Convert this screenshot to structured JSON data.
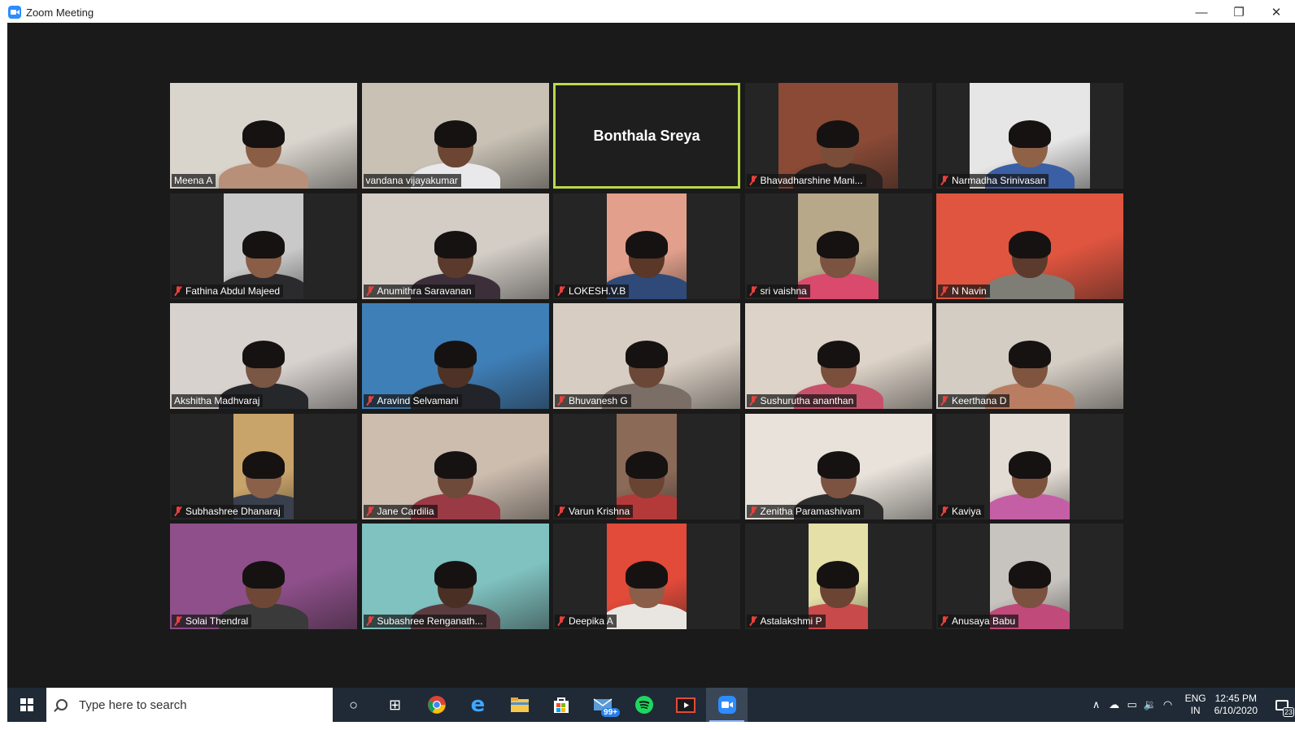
{
  "window": {
    "title": "Zoom Meeting",
    "minimize_glyph": "—",
    "restore_glyph": "❐",
    "close_glyph": "✕"
  },
  "colors": {
    "active_speaker_border": "#b9d94a",
    "muted_icon": "#e8413c",
    "taskbar_bg": "#1f2a36",
    "meeting_bg": "#1a1a1a",
    "zoom_blue": "#2d8cff"
  },
  "participants": [
    {
      "name": "Meena A",
      "muted": false,
      "video": true,
      "bg": "#d9d4cc",
      "skin": "#8a5e45",
      "shirt": "#b88f78",
      "vw": 1.0
    },
    {
      "name": "vandana vijayakumar",
      "muted": false,
      "video": true,
      "bg": "#c8c1b4",
      "skin": "#6c4633",
      "shirt": "#e9e9ec",
      "vw": 1.0
    },
    {
      "name": "Bonthala Sreya",
      "muted": false,
      "video": false,
      "active": true
    },
    {
      "name": "Bhavadharshine Mani...",
      "muted": true,
      "video": true,
      "bg": "#8a4a36",
      "skin": "#7a4d38",
      "shirt": "#2a2220",
      "vw": 0.64
    },
    {
      "name": "Narmadha Srinivasan",
      "muted": true,
      "video": true,
      "bg": "#e6e6e6",
      "skin": "#8f6248",
      "shirt": "#3a5fa4",
      "vw": 0.64
    },
    {
      "name": "Fathina Abdul Majeed",
      "muted": true,
      "video": true,
      "bg": "#c9c9c9",
      "skin": "#8a5d46",
      "shirt": "#2b2b2e",
      "vw": 0.43
    },
    {
      "name": "Anumithra Saravanan",
      "muted": true,
      "video": true,
      "bg": "#d3cdc6",
      "skin": "#5b3a2c",
      "shirt": "#3c2f3a",
      "vw": 1.0
    },
    {
      "name": "LOKESH.V.B",
      "muted": true,
      "video": true,
      "bg": "#e2a08c",
      "skin": "#5a3726",
      "shirt": "#2f4a78",
      "vw": 0.43
    },
    {
      "name": "sri vaishna",
      "muted": true,
      "video": true,
      "bg": "#b8a88a",
      "skin": "#7c5240",
      "shirt": "#d94a6c",
      "vw": 0.43
    },
    {
      "name": "N Navin",
      "muted": true,
      "video": true,
      "bg": "#e0553f",
      "skin": "#5d3b2c",
      "shirt": "#7e7e76",
      "vw": 1.0
    },
    {
      "name": "Akshitha Madhvaraj",
      "muted": false,
      "video": true,
      "bg": "#d8d2cf",
      "skin": "#7a5644",
      "shirt": "#26272b",
      "vw": 1.0
    },
    {
      "name": "Aravind Selvamani",
      "muted": true,
      "video": true,
      "bg": "#3f7fb8",
      "skin": "#4e3226",
      "shirt": "#23242a",
      "vw": 1.0
    },
    {
      "name": "Bhuvanesh G",
      "muted": true,
      "video": true,
      "bg": "#d8cdc2",
      "skin": "#6b4737",
      "shirt": "#7a6e66",
      "vw": 1.0
    },
    {
      "name": "Sushurutha ananthan",
      "muted": true,
      "video": true,
      "bg": "#ddd3c8",
      "skin": "#7a4f3c",
      "shirt": "#c8516a",
      "vw": 1.0
    },
    {
      "name": "Keerthana D",
      "muted": true,
      "video": true,
      "bg": "#d4cdc4",
      "skin": "#7f553f",
      "shirt": "#b97e62",
      "vw": 1.0
    },
    {
      "name": "Subhashree Dhanaraj",
      "muted": true,
      "video": true,
      "bg": "#c9a46a",
      "skin": "#8a6049",
      "shirt": "#3a3f4e",
      "vw": 0.32
    },
    {
      "name": "Jane Cardilia",
      "muted": true,
      "video": true,
      "bg": "#cdbdaf",
      "skin": "#6e4a3a",
      "shirt": "#9a3a45",
      "vw": 1.0
    },
    {
      "name": "Varun Krishna",
      "muted": true,
      "video": true,
      "bg": "#8b6a58",
      "skin": "#6a4433",
      "shirt": "#b43a3a",
      "vw": 0.32
    },
    {
      "name": "Zenitha Paramashivam",
      "muted": true,
      "video": true,
      "bg": "#e8e2da",
      "skin": "#7c5240",
      "shirt": "#2d2d2d",
      "vw": 1.0
    },
    {
      "name": "Kaviya",
      "muted": true,
      "video": true,
      "bg": "#e3dcd4",
      "skin": "#7d533e",
      "shirt": "#c55fa5",
      "vw": 0.43
    },
    {
      "name": "Solai Thendral",
      "muted": true,
      "video": true,
      "bg": "#8e4f8a",
      "skin": "#6e4736",
      "shirt": "#3a3a3a",
      "vw": 1.0
    },
    {
      "name": "Subashree Renganath...",
      "muted": true,
      "video": true,
      "bg": "#7fc2c0",
      "skin": "#4a2f25",
      "shirt": "#5a3c40",
      "vw": 1.0
    },
    {
      "name": "Deepika A",
      "muted": true,
      "video": true,
      "bg": "#e24a3a",
      "skin": "#8a5e48",
      "shirt": "#e9e6e1",
      "vw": 0.43
    },
    {
      "name": "Astalakshmi P",
      "muted": true,
      "video": true,
      "bg": "#e4e0a8",
      "skin": "#6c4434",
      "shirt": "#c94a4a",
      "vw": 0.32
    },
    {
      "name": "Anusaya Babu",
      "muted": true,
      "video": true,
      "bg": "#c7c3bf",
      "skin": "#7b513f",
      "shirt": "#c04a7a",
      "vw": 0.43
    }
  ],
  "taskbar": {
    "search_placeholder": "Type here to search",
    "mail_badge": "99+",
    "language_top": "ENG",
    "language_bottom": "IN",
    "time": "12:45 PM",
    "date": "6/10/2020",
    "notification_count": "23"
  },
  "icons": {
    "cortana": "○",
    "task_view": "⊞",
    "tray_chevron": "∧",
    "onedrive": "☁",
    "battery": "▭",
    "volume": "🔉",
    "wifi": "◠"
  }
}
